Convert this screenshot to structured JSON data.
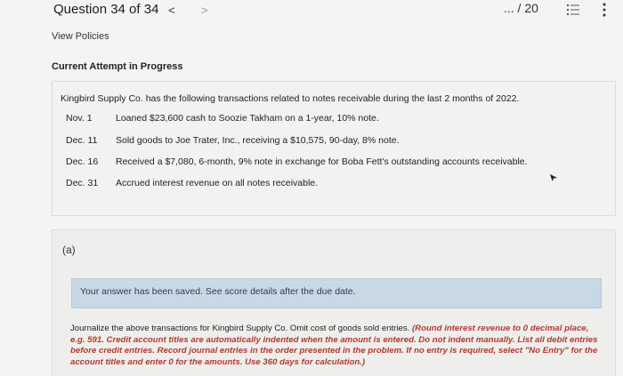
{
  "header": {
    "question_label": "Question 34 of 34",
    "prev_icon": "chevron-left-icon",
    "prev_glyph": "<",
    "next_icon": "chevron-right-icon",
    "next_glyph": ">",
    "score": "... / 20",
    "list_icon": "list-icon",
    "more_icon": "more-vertical-icon"
  },
  "links": {
    "view_policies": "View Policies"
  },
  "attempt_heading": "Current Attempt in Progress",
  "problem": {
    "intro": "Kingbird Supply Co. has the following transactions related to notes receivable during the last 2 months of 2022.",
    "transactions": [
      {
        "date": "Nov. 1",
        "desc": "Loaned $23,600 cash to Soozie Takham on a 1-year, 10% note."
      },
      {
        "date": "Dec. 11",
        "desc": "Sold goods to Joe Trater, Inc., receiving a $10,575, 90-day, 8% note."
      },
      {
        "date": "Dec. 16",
        "desc": "Received a $7,080, 6-month, 9% note in exchange for Boba Fett's outstanding accounts receivable."
      },
      {
        "date": "Dec. 31",
        "desc": "Accrued interest revenue on all notes receivable."
      }
    ]
  },
  "part": {
    "label": "(a)",
    "saved_message": "Your answer has been saved. See score details after the due date.",
    "instruction_plain": "Journalize the above transactions for Kingbird Supply Co. Omit cost of goods sold entries.",
    "instruction_emphasis": "(Round interest revenue to 0 decimal place, e.g. 591. Credit account titles are automatically indented when the amount is entered. Do not indent manually. List all debit entries before credit entries. Record journal entries in the order presented in the problem. If no entry is required, select \"No Entry\" for the account titles and enter 0 for the amounts. Use 360 days for calculation.)"
  },
  "colors": {
    "background": "#f4f4f2",
    "saved_bar": "#c9d8e5",
    "emphasis_red": "#b23a2c"
  }
}
